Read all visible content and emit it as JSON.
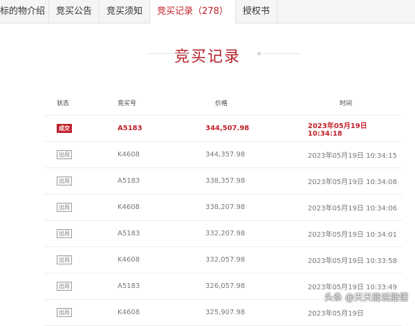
{
  "tabs": [
    {
      "label": "标的物介绍"
    },
    {
      "label": "竞买公告"
    },
    {
      "label": "竞买须知"
    },
    {
      "label": "竞买记录（278）",
      "active": true
    },
    {
      "label": "授权书"
    }
  ],
  "section_title": "竞买记录",
  "table": {
    "headers": {
      "status": "状态",
      "number": "竞买号",
      "price": "价格",
      "time": "时间"
    },
    "rows": [
      {
        "status": "成交",
        "number": "A5183",
        "price": "344,507.98",
        "time": "2023年05月19日 10:34:18"
      },
      {
        "status": "出局",
        "number": "K4608",
        "price": "344,357.98",
        "time": "2023年05月19日 10:34:15"
      },
      {
        "status": "出局",
        "number": "A5183",
        "price": "338,357.98",
        "time": "2023年05月19日 10:34:08"
      },
      {
        "status": "出局",
        "number": "K4608",
        "price": "338,207.98",
        "time": "2023年05月19日 10:34:06"
      },
      {
        "status": "出局",
        "number": "A5183",
        "price": "332,207.98",
        "time": "2023年05月19日 10:34:01"
      },
      {
        "status": "出局",
        "number": "K4608",
        "price": "332,057.98",
        "time": "2023年05月19日 10:33:58"
      },
      {
        "status": "出局",
        "number": "A5183",
        "price": "326,057.98",
        "time": "2023年05月19日 10:33:49"
      },
      {
        "status": "出局",
        "number": "K4608",
        "price": "325,907.98",
        "time": "2023年05月19日"
      }
    ]
  },
  "watermark": "头条 @天天能说能懂"
}
